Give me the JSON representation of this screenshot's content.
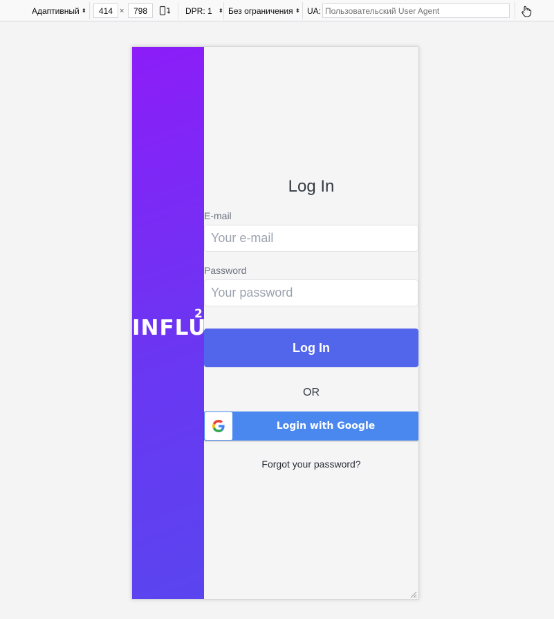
{
  "toolbar": {
    "device_label": "Адаптивный",
    "width_value": "414",
    "height_value": "798",
    "times": "×",
    "dpr_label": "DPR: 1",
    "throttle_label": "Без ограничения",
    "ua_label": "UA:",
    "ua_placeholder": "Пользовательский User Agent"
  },
  "brand": {
    "logo_text": "INFLU",
    "logo_sup": "2"
  },
  "form": {
    "title": "Log In",
    "email_label": "E-mail",
    "email_placeholder": "Your e-mail",
    "password_label": "Password",
    "password_placeholder": "Your password",
    "login_button": "Log In",
    "or_text": "OR",
    "google_button": "Login with Google",
    "forgot_link": "Forgot your password?"
  },
  "colors": {
    "gradient_start": "#8c1df8",
    "gradient_end": "#5a45f0",
    "login_button": "#5266ec",
    "google_button": "#4a88f0"
  }
}
